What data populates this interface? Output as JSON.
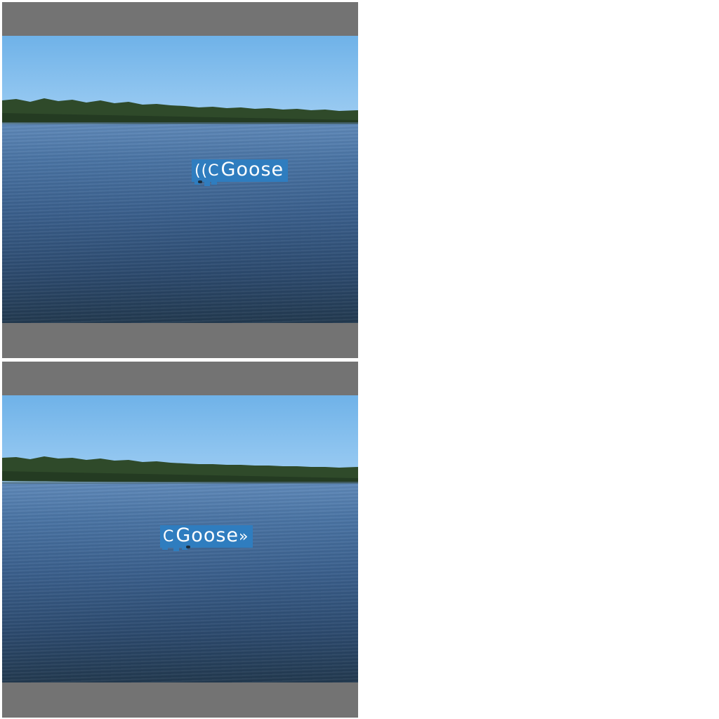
{
  "panels": [
    {
      "id": "top",
      "detection_label": "Goose",
      "prefix_marks": "((C",
      "suffix_marks": ""
    },
    {
      "id": "bottom",
      "detection_label": "Goose",
      "prefix_marks": "C",
      "suffix_marks": "»"
    }
  ],
  "colors": {
    "letterbox": "#737373",
    "label_box": "#2f7dbf",
    "sky": "#8cc3ef",
    "water": "#3a5f8c",
    "trees": "#2f4a2a"
  }
}
